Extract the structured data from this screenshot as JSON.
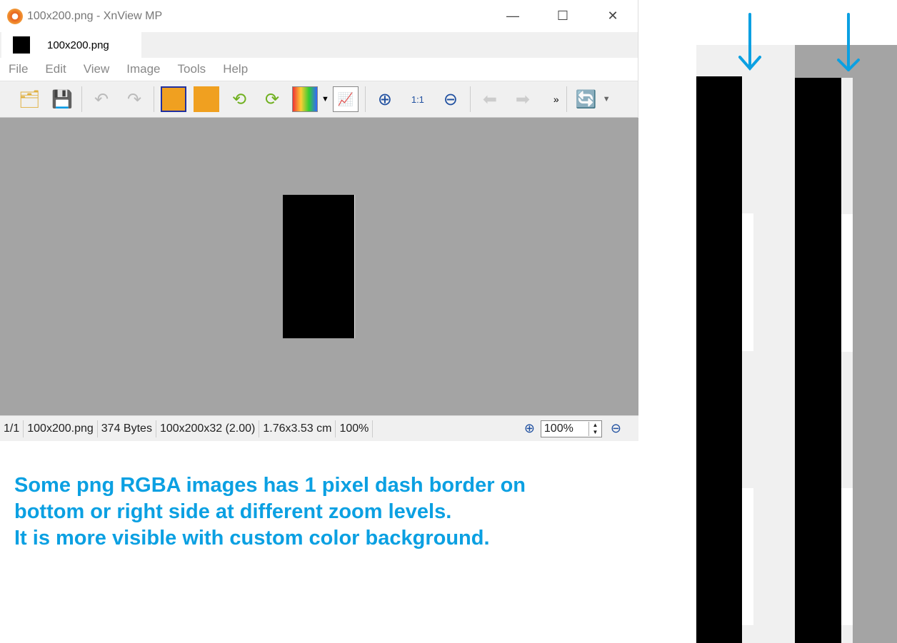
{
  "window": {
    "title": "100x200.png - XnView MP",
    "controls": [
      "—",
      "☐",
      "✕"
    ]
  },
  "tab": {
    "label": "100x200.png"
  },
  "menu": [
    "File",
    "Edit",
    "View",
    "Image",
    "Tools",
    "Help"
  ],
  "toolbar": [
    "browser-icon",
    "save-icon",
    "undo-icon",
    "redo-icon",
    "crop-icon",
    "resize-icon",
    "rotate-left-icon",
    "rotate-right-icon",
    "color-adjust-icon",
    "levels-icon",
    "zoom-in-icon",
    "zoom-actual-icon",
    "zoom-out-icon",
    "previous-icon",
    "next-icon"
  ],
  "toolbar_more": "»",
  "status": {
    "index": "1/1",
    "filename": "100x200.png",
    "size": "374 Bytes",
    "dims": "100x200x32 (2.00)",
    "physical": "1.76x3.53 cm",
    "zoom": "100%",
    "zoom_input": "100%"
  },
  "note": {
    "line1": "Some png RGBA images has 1 pixel dash border on",
    "line2": "bottom or right side at different zoom levels.",
    "line3": "It is more visible with custom color background."
  },
  "colors": {
    "accent": "#0ba0e2",
    "canvas": "#a4a4a4"
  }
}
